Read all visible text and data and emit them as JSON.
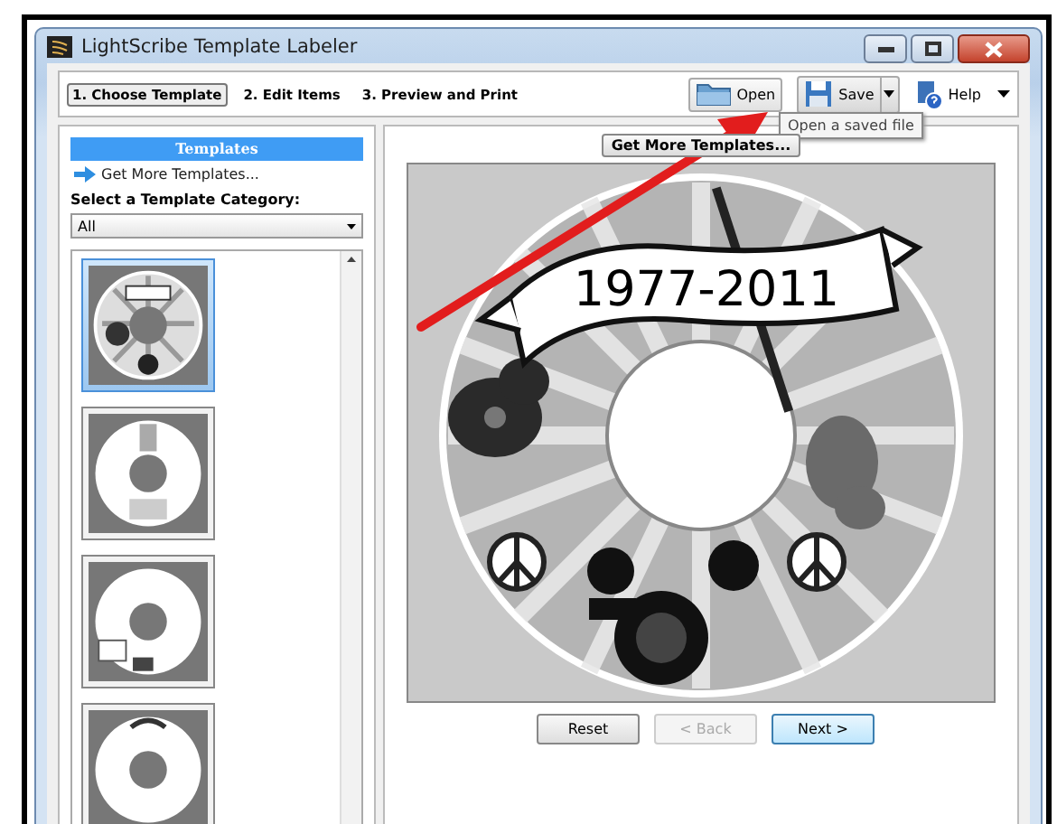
{
  "window": {
    "title": "LightScribe Template Labeler"
  },
  "steps": [
    {
      "label": "1. Choose Template",
      "selected": true
    },
    {
      "label": "2. Edit Items",
      "selected": false
    },
    {
      "label": "3. Preview and Print",
      "selected": false
    }
  ],
  "toolbar": {
    "open": "Open",
    "save": "Save",
    "help": "Help",
    "tooltip": "Open a saved file"
  },
  "templates_panel": {
    "title": "Templates",
    "link": "Get More Templates...",
    "category_label": "Select a Template Category:",
    "category": "All",
    "templates": [
      {
        "kind": "tie-dye",
        "selected": true
      },
      {
        "kind": "tree",
        "selected": false
      },
      {
        "kind": "photo-frame",
        "selected": false
      },
      {
        "kind": "floral",
        "selected": false
      }
    ]
  },
  "preview": {
    "more_button": "Get More Templates...",
    "disc_title": "1977-2011"
  },
  "nav_buttons": [
    {
      "label": "Reset",
      "disabled": false,
      "default": false
    },
    {
      "label": "< Back",
      "disabled": true,
      "default": false
    },
    {
      "label": "Next >",
      "disabled": false,
      "default": true
    }
  ]
}
